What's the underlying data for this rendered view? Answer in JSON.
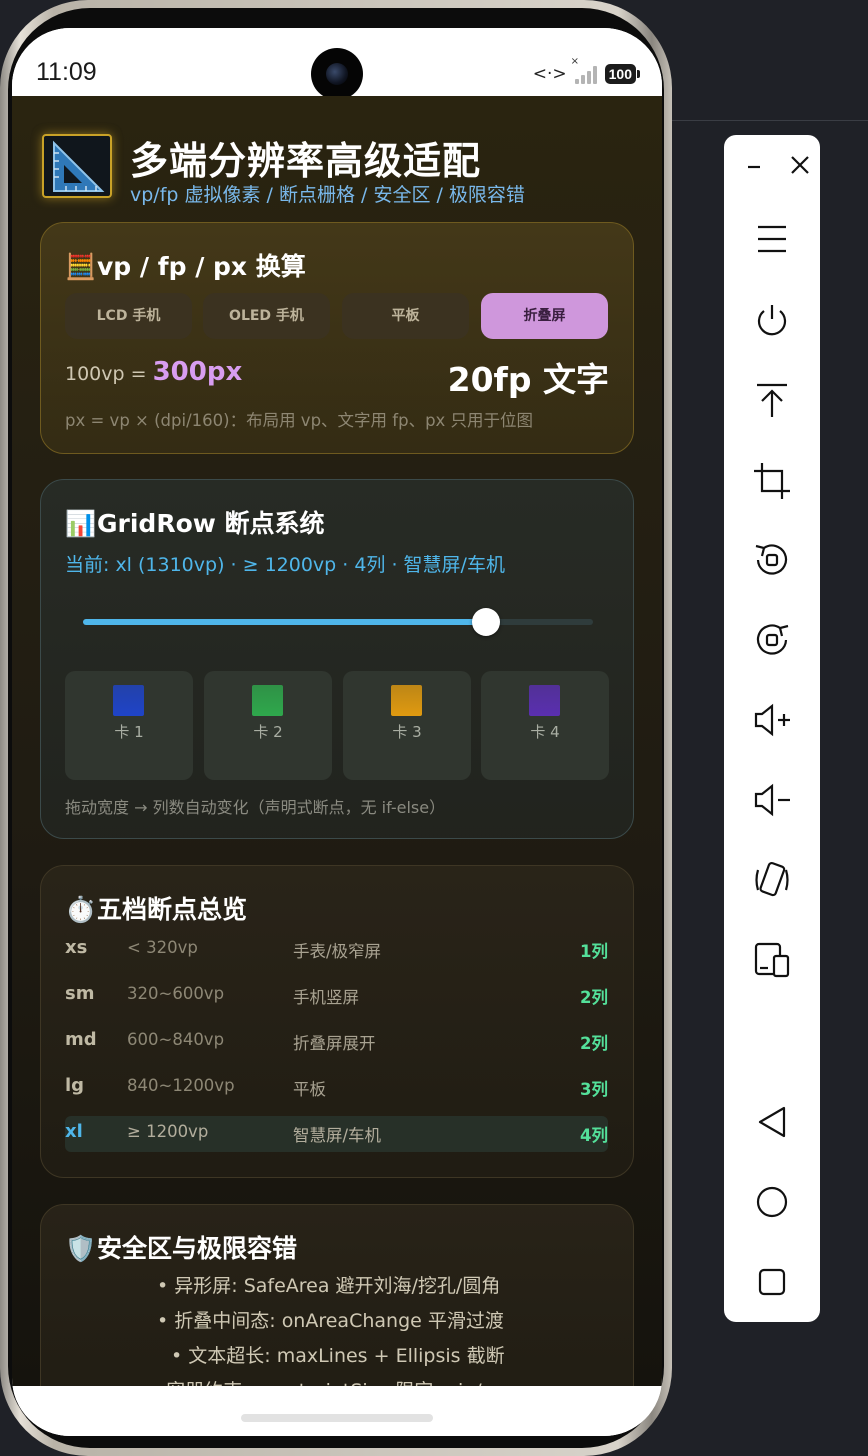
{
  "status_bar": {
    "time": "11:09",
    "battery": "100"
  },
  "header": {
    "title": "多端分辨率高级适配",
    "subtitle": "vp/fp 虚拟像素 / 断点栅格 / 安全区 / 极限容错",
    "icon": "set-square-icon"
  },
  "conversion_card": {
    "emoji": "🧮",
    "title": "vp / fp / px 换算",
    "devices": [
      "LCD 手机",
      "OLED 手机",
      "平板",
      "折叠屏"
    ],
    "selected_device": "折叠屏",
    "vp_label": "100vp = ",
    "px_value": "300px",
    "fp_sample": "20fp 文字",
    "note": "px = vp × (dpi/160)：布局用 vp、文字用 fp、px 只用于位图"
  },
  "gridrow_card": {
    "emoji": "📊",
    "title": "GridRow 断点系统",
    "status": "当前: xl (1310vp) · ≥ 1200vp · 4列 · 智慧屏/车机",
    "slider_value": 0.79,
    "cards": [
      {
        "label": "卡 1",
        "color": "#1f44c8"
      },
      {
        "label": "卡 2",
        "color": "#2fa84c"
      },
      {
        "label": "卡 3",
        "color": "#e09a10"
      },
      {
        "label": "卡 4",
        "color": "#5a2fb0"
      }
    ],
    "note": "拖动宽度 → 列数自动变化（声明式断点，无 if-else）"
  },
  "breakpoints_card": {
    "emoji": "⏱️",
    "title": "五档断点总览",
    "rows": [
      {
        "key": "xs",
        "range": "< 320vp",
        "desc": "手表/极窄屏",
        "cols": "1列"
      },
      {
        "key": "sm",
        "range": "320~600vp",
        "desc": "手机竖屏",
        "cols": "2列"
      },
      {
        "key": "md",
        "range": "600~840vp",
        "desc": "折叠屏展开",
        "cols": "2列"
      },
      {
        "key": "lg",
        "range": "840~1200vp",
        "desc": "平板",
        "cols": "3列"
      },
      {
        "key": "xl",
        "range": "≥ 1200vp",
        "desc": "智慧屏/车机",
        "cols": "4列"
      }
    ],
    "active_key": "xl"
  },
  "safearea_card": {
    "emoji": "🛡️",
    "title": "安全区与极限容错",
    "bullets": [
      "• 异形屏: SafeArea 避开刘海/挖孔/圆角",
      "• 折叠中间态: onAreaChange 平滑过渡",
      "• 文本超长: maxLines + Ellipsis 截断",
      "• 容器约束: constraintSize 限定 min/max"
    ]
  },
  "toolbar": {
    "items": [
      "minimize-icon",
      "close-icon",
      "menu-icon",
      "power-icon",
      "pin-top-icon",
      "crop-icon",
      "rotate-left-icon",
      "rotate-right-icon",
      "volume-up-icon",
      "volume-down-icon",
      "shake-icon",
      "fold-icon",
      "back-icon",
      "home-icon",
      "recents-icon"
    ]
  },
  "colors": {
    "accent_blue": "#4fb6ea",
    "accent_purple": "#cf97dc",
    "accent_green": "#54e09a",
    "gold": "#c9a227"
  }
}
